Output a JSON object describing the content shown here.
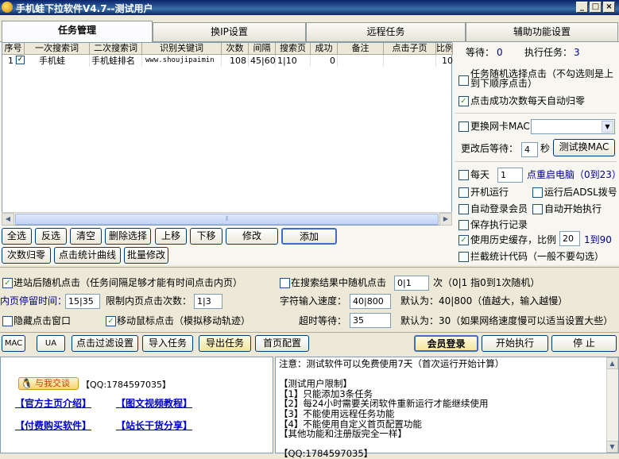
{
  "window": {
    "title": "手机蛙下拉软件V4.7--测试用户"
  },
  "tabs": [
    {
      "label": "任务管理",
      "active": true
    },
    {
      "label": "换IP设置",
      "active": false
    },
    {
      "label": "远程任务",
      "active": false
    },
    {
      "label": "辅助功能设置",
      "active": false
    }
  ],
  "grid": {
    "headers": [
      "序号",
      "一次搜索词",
      "二次搜索词",
      "识别关键词",
      "次数",
      "间隔",
      "搜索页",
      "成功",
      "备注",
      "点击子页",
      "比例"
    ],
    "rows": [
      [
        "1",
        "手机蛙",
        "手机蛙排名",
        "www.shoujipaimin",
        "108",
        "45|60",
        "1|10",
        "0",
        "",
        "",
        "10"
      ]
    ]
  },
  "status": {
    "waiting_label": "等待：",
    "waiting_value": "0",
    "running_label": "执行任务：",
    "running_value": "3"
  },
  "right_options": {
    "random_click": "任务随机选择点击（不勾选则是上到下顺序点击）",
    "auto_reset": "点击成功次数每天自动归零",
    "change_mac": "更换网卡MAC",
    "change_wait_label": "更改后等待：",
    "change_wait_value": "4",
    "change_wait_unit": "秒",
    "test_mac_btn": "测试换MAC",
    "daily_label": "每天",
    "daily_value": "1",
    "daily_suffix": "点重启电脑（0到23）",
    "boot_run": "开机运行",
    "adsl_dial": "运行后ADSL拨号",
    "auto_login": "自动登录会员",
    "auto_start": "自动开始执行",
    "save_record": "保存执行记录",
    "history_cache": "使用历史缓存，比例",
    "history_value": "20",
    "history_range": "1到90",
    "block_stats": "拦截统计代码（一般不要勾选）"
  },
  "actions": {
    "select_all": "全选",
    "invert": "反选",
    "clear": "清空",
    "delete_sel": "删除选择",
    "move_up": "上移",
    "move_down": "下移",
    "edit": "修改",
    "add": "添加",
    "reset_count": "次数归零",
    "click_curve": "点击统计曲线",
    "batch_edit": "批量修改"
  },
  "settings": {
    "enter_random": "进站后随机点击（任务间隔足够才能有时间点击内页）",
    "in_results_random": "在搜索结果中随机点击",
    "in_results_value": "0|1",
    "in_results_hint": "次（0|1 指0到1次随机）",
    "inner_stay_label": "内页停留时间：",
    "inner_stay_value": "15|35",
    "inner_limit_label": "限制内页点击次数：",
    "inner_limit_value": "1|3",
    "typing_speed_label": "字符输入速度：",
    "typing_speed_value": "40|800",
    "typing_speed_hint": "默认为：40|800（值越大，输入越慢）",
    "hide_window": "隐藏点击窗口",
    "move_mouse": "移动鼠标点击（模拟移动轨迹）",
    "timeout_label": "超时等待：",
    "timeout_value": "35",
    "timeout_hint": "默认为：30（如果网络速度慢可以适当设置大些）"
  },
  "toolbar": {
    "mac": "MAC",
    "ua": "UA",
    "click_filter": "点击过滤设置",
    "import": "导入任务",
    "export": "导出任务",
    "home_config": "首页配置",
    "member_login": "会员登录",
    "start": "开始执行",
    "stop": "停 止"
  },
  "links": {
    "qq_badge": "与我交谈",
    "qq_label": "【QQ:1784597035】",
    "official": "【官方主页介绍】",
    "video": "【图文视频教程】",
    "buy": "【付费购买软件】",
    "share": "【站长干货分享】"
  },
  "notes": "注意：测试软件可以免费使用7天（首次运行开始计算）\n\n【测试用户限制】\n【1】只能添加3条任务\n【2】每24小时需要关闭软件重新运行才能继续使用\n【3】不能使用远程任务功能\n【4】不能使用自定义首页配置功能\n【其他功能和注册版完全一样】\n\n【QQ:1784597035】"
}
